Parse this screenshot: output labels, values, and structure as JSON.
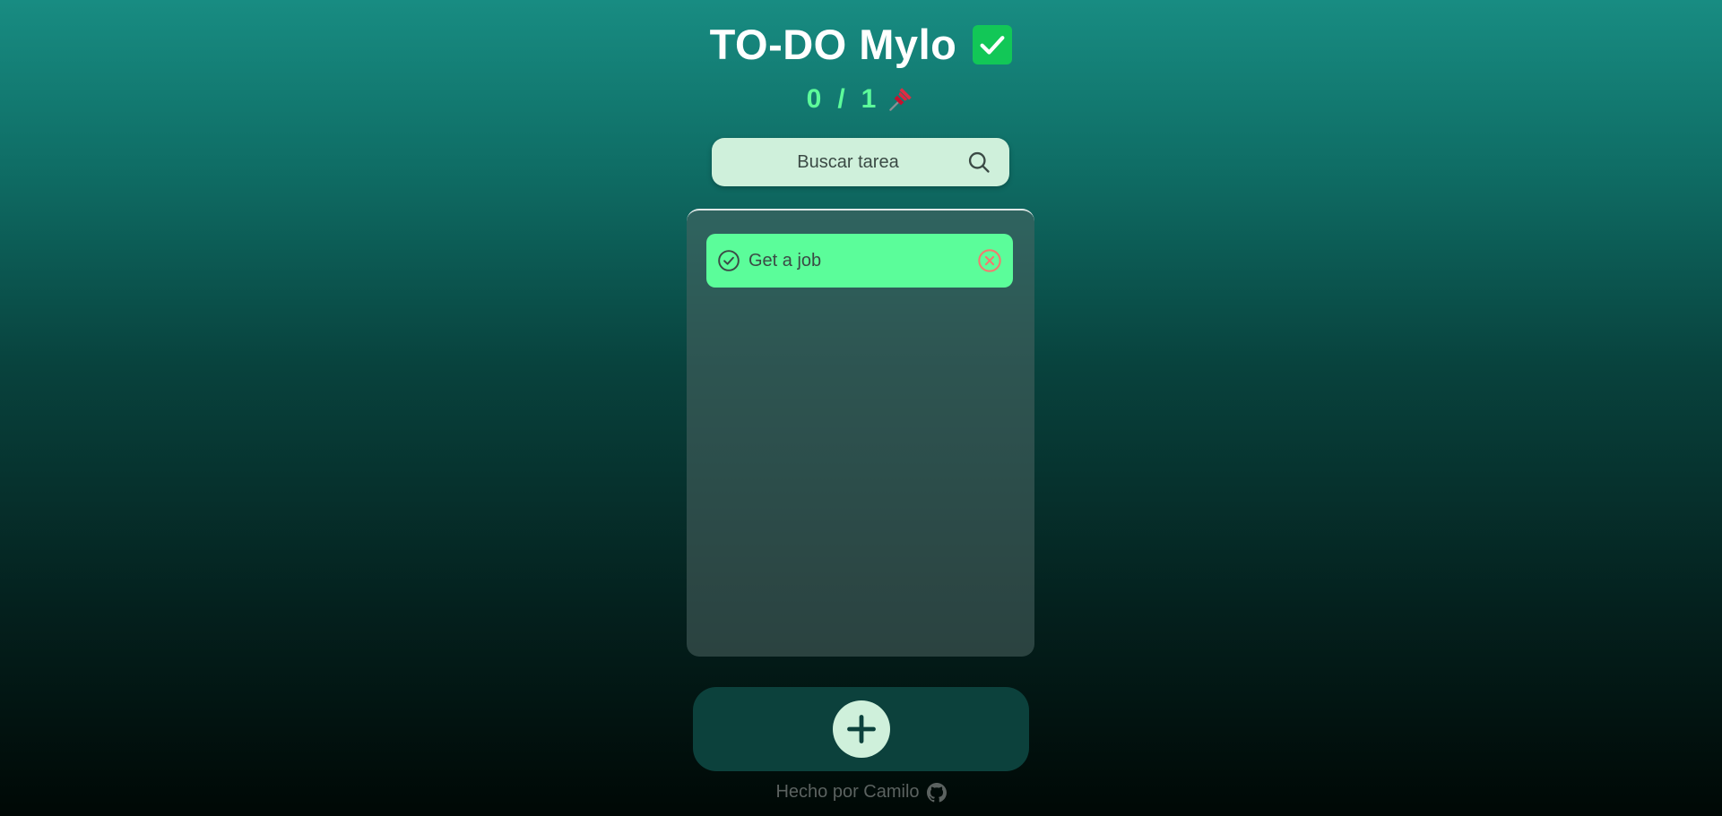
{
  "app": {
    "title": "TO-DO Mylo",
    "title_icon": "check-mark-icon",
    "brand_green": "#12c757",
    "accent_green": "#5bfd9a"
  },
  "counter": {
    "completed": "0",
    "separator": "/",
    "total": "1",
    "icon": "pushpin-icon"
  },
  "search": {
    "placeholder": "Buscar tarea",
    "icon": "search-icon"
  },
  "todos": [
    {
      "text": "Get a job",
      "completed": false,
      "check_icon": "check-circle-icon",
      "delete_icon": "close-circle-icon",
      "delete_color": "#f07d6f"
    }
  ],
  "add_button": {
    "icon": "plus-icon"
  },
  "footer": {
    "text": "Hecho por Camilo",
    "icon": "github-icon"
  }
}
